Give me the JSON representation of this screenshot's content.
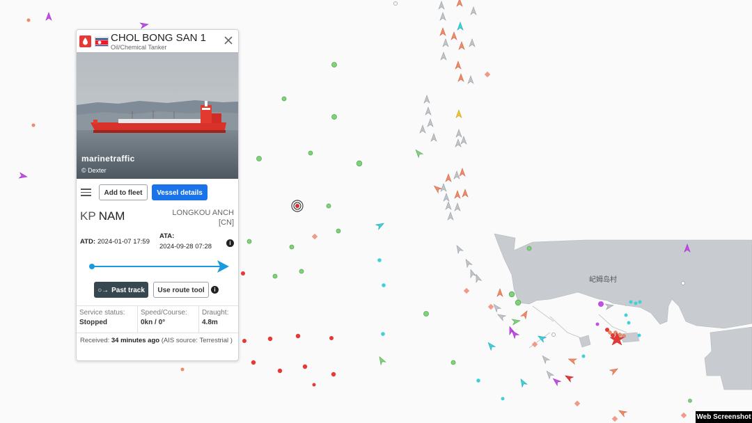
{
  "map": {
    "place_label": "屺姆岛村",
    "land_color": "#c8cbd0",
    "water_color": "#fafafa",
    "colors": {
      "green": "#7ed27a",
      "red": "#e53935",
      "orange": "#ee8a68",
      "gray": "#bfc4c9",
      "cyan": "#3fd1d9",
      "purple": "#c34ee6",
      "yellow": "#f1c232"
    }
  },
  "panel": {
    "vessel_name": "CHOL BONG SAN 1",
    "vessel_type": "Oil/Chemical Tanker",
    "watermark": "marinetraffic",
    "photo_credit": "© Dexter",
    "buttons": {
      "add_fleet": "Add to fleet",
      "vessel_details": "Vessel details",
      "past_track": "Past track",
      "route_tool": "Use route tool"
    },
    "destination_country": "KP",
    "destination_port": "NAM",
    "current_port": "LONGKOU ANCH",
    "current_port_country": "[CN]",
    "atd_label": "ATD:",
    "atd_value": "2024-01-07 17:59",
    "ata_label": "ATA:",
    "ata_value": "2024-09-28 07:28",
    "info_glyph": "i",
    "service_status_label": "Service status:",
    "service_status_value": "Stopped",
    "speed_label": "Speed/Course:",
    "speed_value": "0kn / 0°",
    "draught_label": "Draught:",
    "draught_value": "4.8m",
    "received_prefix": "Received:",
    "received_value": "34 minutes ago",
    "received_suffix": "(AIS source: Terrestrial )"
  },
  "badge": "Web Screenshot"
}
